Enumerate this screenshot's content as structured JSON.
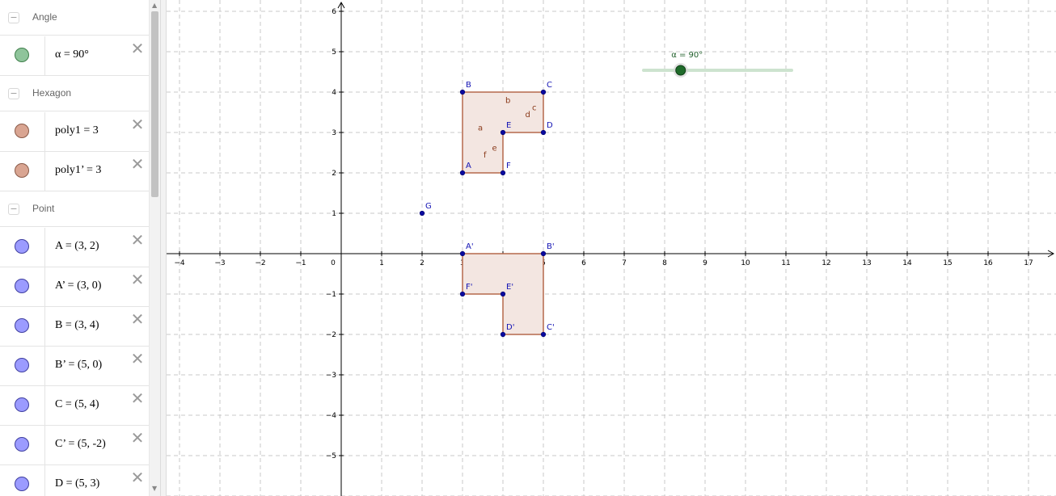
{
  "algebra": {
    "groups": [
      {
        "label": "Angle",
        "items": [
          {
            "text": "α = 90°",
            "color": "#8fc49b",
            "stroke": "#3f7f4b"
          }
        ]
      },
      {
        "label": "Hexagon",
        "items": [
          {
            "text": "poly1 = 3",
            "color": "#d9a592",
            "stroke": "#8a5a48"
          },
          {
            "text": "poly1’ = 3",
            "color": "#d9a592",
            "stroke": "#8a5a48"
          }
        ]
      },
      {
        "label": "Point",
        "items": [
          {
            "text": "A = (3, 2)",
            "color": "#9b9bff",
            "stroke": "#3f3f9f"
          },
          {
            "text": "A’ = (3, 0)",
            "color": "#9b9bff",
            "stroke": "#3f3f9f"
          },
          {
            "text": "B = (3, 4)",
            "color": "#9b9bff",
            "stroke": "#3f3f9f"
          },
          {
            "text": "B’ = (5, 0)",
            "color": "#9b9bff",
            "stroke": "#3f3f9f"
          },
          {
            "text": "C = (5, 4)",
            "color": "#9b9bff",
            "stroke": "#3f3f9f"
          },
          {
            "text": "C’ = (5, -2)",
            "color": "#9b9bff",
            "stroke": "#3f3f9f"
          },
          {
            "text": "D = (5, 3)",
            "color": "#9b9bff",
            "stroke": "#3f3f9f"
          }
        ]
      }
    ],
    "toggle_icon": "minus-icon",
    "delete_symbol": "✕"
  },
  "graphics": {
    "x_ticks": [
      "−4",
      "−3",
      "−2",
      "−1",
      "0",
      "1",
      "2",
      "3",
      "4",
      "5",
      "6",
      "7",
      "8",
      "9",
      "10",
      "11",
      "12",
      "13",
      "14",
      "15",
      "16",
      "17"
    ],
    "y_ticks": [
      "6",
      "5",
      "4",
      "3",
      "2",
      "1",
      "−1",
      "−2",
      "−3",
      "−4",
      "−5"
    ],
    "x_tick_values": [
      -4,
      -3,
      -2,
      -1,
      0,
      1,
      2,
      3,
      4,
      5,
      6,
      7,
      8,
      9,
      10,
      11,
      12,
      13,
      14,
      15,
      16,
      17
    ],
    "y_tick_values": [
      6,
      5,
      4,
      3,
      2,
      1,
      -1,
      -2,
      -3,
      -4,
      -5
    ],
    "polygon1": [
      [
        3,
        2
      ],
      [
        3,
        4
      ],
      [
        5,
        4
      ],
      [
        5,
        3
      ],
      [
        4,
        3
      ],
      [
        4,
        2
      ]
    ],
    "polygon2": [
      [
        3,
        0
      ],
      [
        5,
        0
      ],
      [
        5,
        -2
      ],
      [
        4,
        -2
      ],
      [
        4,
        -1
      ],
      [
        3,
        -1
      ]
    ],
    "points": [
      {
        "label": "A",
        "x": 3,
        "y": 2
      },
      {
        "label": "B",
        "x": 3,
        "y": 4
      },
      {
        "label": "C",
        "x": 5,
        "y": 4
      },
      {
        "label": "D",
        "x": 5,
        "y": 3
      },
      {
        "label": "E",
        "x": 4,
        "y": 3
      },
      {
        "label": "F",
        "x": 4,
        "y": 2
      },
      {
        "label": "G",
        "x": 2,
        "y": 1
      },
      {
        "label": "A'",
        "x": 3,
        "y": 0
      },
      {
        "label": "B'",
        "x": 5,
        "y": 0
      },
      {
        "label": "C'",
        "x": 5,
        "y": -2
      },
      {
        "label": "D'",
        "x": 4,
        "y": -2
      },
      {
        "label": "E'",
        "x": 4,
        "y": -1
      },
      {
        "label": "F'",
        "x": 3,
        "y": -1
      }
    ],
    "segment_labels": [
      {
        "label": "a",
        "x": 3.38,
        "y": 3.05
      },
      {
        "label": "b",
        "x": 4.06,
        "y": 3.73
      },
      {
        "label": "c",
        "x": 4.72,
        "y": 3.55
      },
      {
        "label": "d",
        "x": 4.55,
        "y": 3.38
      },
      {
        "label": "e",
        "x": 3.73,
        "y": 2.55
      },
      {
        "label": "f",
        "x": 3.52,
        "y": 2.38
      }
    ],
    "slider": {
      "label": "α = 90°",
      "value": 90,
      "min": 0,
      "max": 360
    },
    "colors": {
      "polygon_fill": "#f3e6e1",
      "polygon_stroke": "#b5694c",
      "point": "#0a0a9f",
      "label_blue": "#1414b4",
      "label_brown": "#8a3a1a",
      "slider_track": "#cde3cf",
      "slider_knob": "#1f6b2a",
      "slider_label": "#1f5f2a",
      "grid": "#c8c8c8"
    }
  }
}
